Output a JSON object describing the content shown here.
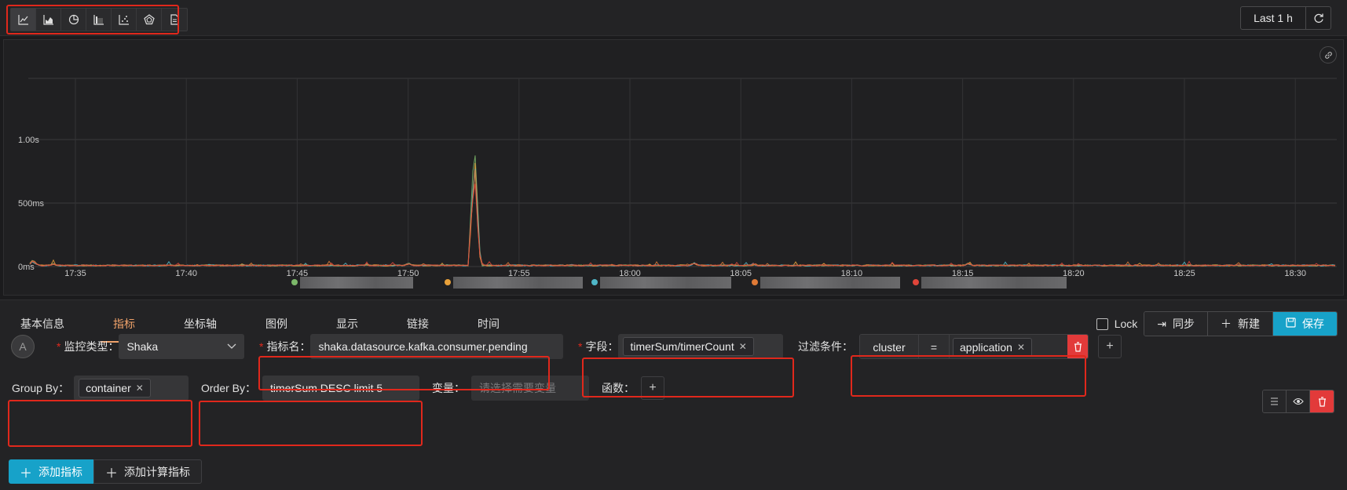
{
  "toolbar": {
    "chart_types": [
      {
        "icon": "line-chart-icon",
        "active": true
      },
      {
        "icon": "area-chart-icon",
        "active": false
      },
      {
        "icon": "pie-chart-icon",
        "active": false
      },
      {
        "icon": "bar-chart-icon",
        "active": false
      },
      {
        "icon": "scatter-chart-icon",
        "active": false
      },
      {
        "icon": "radar-chart-icon",
        "active": false
      },
      {
        "icon": "document-icon",
        "active": false
      }
    ],
    "time_range": "Last 1 h",
    "refresh_icon": "refresh-icon"
  },
  "chart_data": {
    "type": "line",
    "y_ticks": [
      "1.00s",
      "500ms",
      "0ms"
    ],
    "x_ticks": [
      "17:35",
      "17:40",
      "17:45",
      "17:50",
      "17:55",
      "18:00",
      "18:05",
      "18:10",
      "18:15",
      "18:20",
      "18:25",
      "18:30"
    ],
    "ylim_ms": [
      0,
      1000
    ],
    "grid": true,
    "legend_placement": "bottom",
    "series": [
      {
        "color": "#7cb86a"
      },
      {
        "color": "#e8a13a"
      },
      {
        "color": "#4fb7c8"
      },
      {
        "color": "#e07a36"
      },
      {
        "color": "#e0453a"
      }
    ]
  },
  "tabs": [
    "基本信息",
    "指标",
    "坐标轴",
    "图例",
    "显示",
    "链接",
    "时间"
  ],
  "active_tab": 1,
  "actions": {
    "lock": "Lock",
    "sync": "同步",
    "new": "新建",
    "save": "保存"
  },
  "query": {
    "avatar": "A",
    "monitor_type_label": "监控类型：",
    "monitor_type_value": "Shaka",
    "metric_name_label": "指标名：",
    "metric_name_value": "shaka.datasource.kafka.consumer.pending",
    "field_label": "字段：",
    "field_value": "timerSum/timerCount",
    "filter_label": "过滤条件：",
    "filter_key": "cluster",
    "filter_op": "=",
    "filter_value": "application",
    "group_by_label": "Group By：",
    "group_by_value": "container",
    "order_by_label": "Order By：",
    "order_by_value": "timerSum DESC limit 5",
    "variable_label": "变量：",
    "variable_placeholder": "请选择需要变量",
    "function_label": "函数："
  },
  "add_buttons": {
    "add_metric": "添加指标",
    "add_calc_metric": "添加计算指标"
  }
}
